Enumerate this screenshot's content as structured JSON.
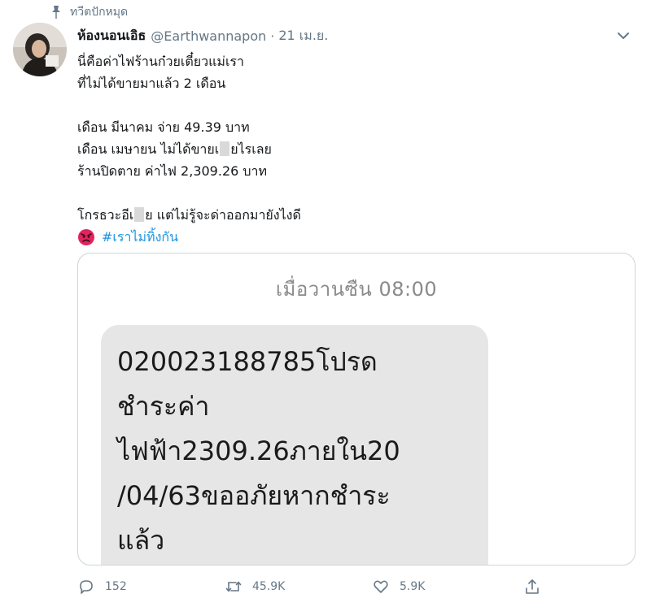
{
  "pinned_label": "ทวีตปักหมุด",
  "author": {
    "display_name": "ห้องนอนเอิธ",
    "handle": "@Earthwannapon",
    "separator": "·",
    "timestamp": "21 เม.ย."
  },
  "tweet": {
    "line1": "นี่คือค่าไฟร้านก๋วยเตี๋ยวแม่เรา",
    "line2": "ที่ไม่ได้ขายมาแล้ว 2 เดือน",
    "line3": "เดือน มีนาคม จ่าย 49.39 บาท",
    "line4_a": "เดือน เมษายน ไม่ได้ขายเ",
    "line4_b": "ยไรเลย",
    "line5": "ร้านปิดตาย ค่าไฟ 2,309.26 บาท",
    "line6_a": "โกรธวะอีเ",
    "line6_b": "ย แต่ไม่รู้จะด่าออกมายังไงดี",
    "hashtag": "#เราไม่ทิ้งกัน",
    "emoji": "angry-face"
  },
  "media": {
    "sms_time": "เมื่อวานซืน 08:00",
    "sms_lines": [
      "020023188785โปรด",
      "ชำระค่า",
      "ไฟฟ้า2309.26ภายใน20",
      "/04/63ขออภัยหากชำระ",
      "แล้ว"
    ]
  },
  "actions": {
    "replies": "152",
    "retweets": "45.9K",
    "likes": "5.9K"
  },
  "colors": {
    "link": "#1b95e0",
    "muted": "#657786",
    "bubble": "#e6e6e6"
  }
}
